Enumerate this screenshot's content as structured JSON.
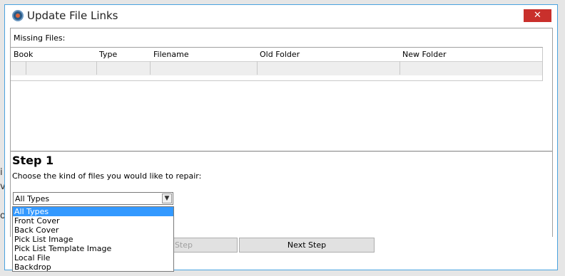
{
  "window": {
    "title": "Update File Links",
    "close_label": "✕"
  },
  "missing_files_label": "Missing Files:",
  "table": {
    "columns": [
      "Book",
      "Type",
      "Filename",
      "Old Folder",
      "New Folder"
    ]
  },
  "step": {
    "title": "Step 1",
    "description": "Choose the kind of files you would like to repair:"
  },
  "file_type_select": {
    "value": "All Types",
    "options": [
      "All Types",
      "Front Cover",
      "Back Cover",
      "Pick List Image",
      "Pick List Template Image",
      "Local File",
      "Backdrop"
    ]
  },
  "buttons": {
    "prev_step": "Step",
    "next_step": "Next Step"
  },
  "background_fragments": [
    "i",
    "v",
    "o"
  ]
}
